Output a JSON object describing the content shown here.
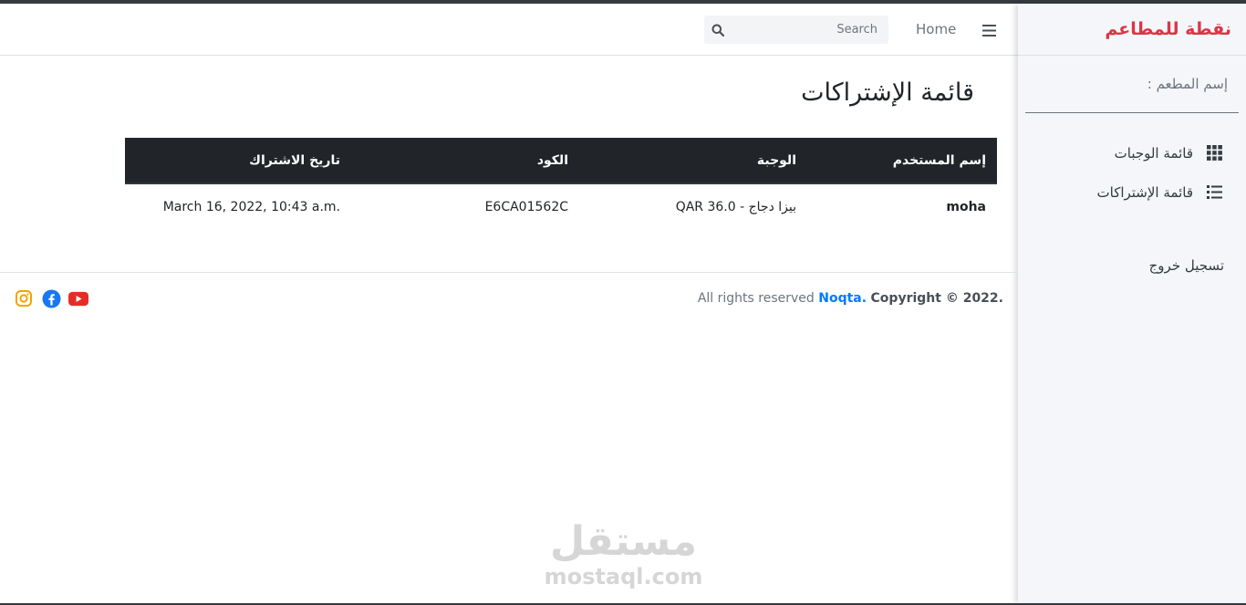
{
  "brand": {
    "name": "نقطة للمطاعم",
    "color": "#dc3545"
  },
  "sidebar": {
    "restaurant_label": "إسم المطعم :",
    "items": [
      {
        "label": "قائمة الوجبات",
        "icon": "grid-icon"
      },
      {
        "label": "قائمة الإشتراكات",
        "icon": "list-icon"
      }
    ],
    "logout_label": "تسجيل خروج"
  },
  "navbar": {
    "home_label": "Home",
    "search_placeholder": "Search"
  },
  "page": {
    "title": "قائمة الإشتراكات"
  },
  "table": {
    "headers": [
      "إسم المستخدم",
      "الوجبة",
      "الكود",
      "تاريخ الاشتراك"
    ],
    "rows": [
      [
        "moha",
        "بيزا دجاج - QAR 36.0",
        "E6CA01562C",
        "March 16, 2022, 10:43 a.m."
      ]
    ]
  },
  "footer": {
    "copyright_prefix": "Copyright © 2022",
    "brand_link": "Noqta.",
    "suffix": "All rights reserved",
    "socials": [
      "youtube-icon",
      "facebook-icon",
      "instagram-icon"
    ]
  },
  "watermark": {
    "arabic": "مستقل",
    "latin": "mostaql.com"
  }
}
